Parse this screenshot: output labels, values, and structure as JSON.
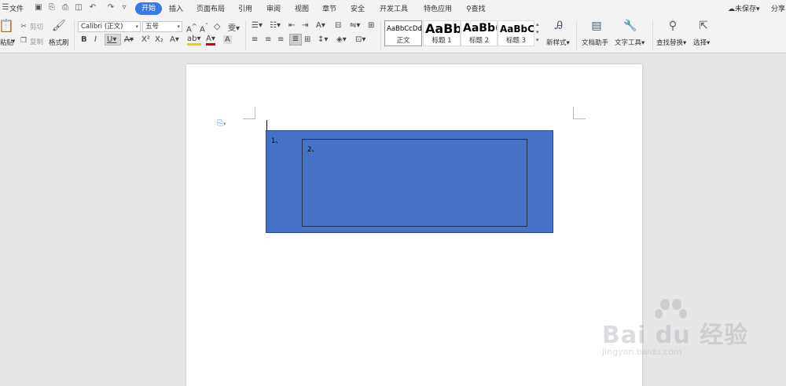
{
  "menubar": {
    "file": "文件",
    "tabs": [
      "开始",
      "插入",
      "页面布局",
      "引用",
      "审阅",
      "视图",
      "章节",
      "安全",
      "开发工具",
      "特色应用"
    ],
    "search": "查找",
    "unsaved": "未保存",
    "share": "分享"
  },
  "ribbon": {
    "paste": "粘贴",
    "cut": "剪切",
    "copy": "复制",
    "format_painter": "格式刷",
    "font_name": "Calibri (正文)",
    "font_size": "五号",
    "styles": [
      {
        "preview": "AaBbCcDd",
        "name": "正文"
      },
      {
        "preview": "AaBb",
        "name": "标题 1"
      },
      {
        "preview": "AaBb(",
        "name": "标题 2"
      },
      {
        "preview": "AaBbC",
        "name": "标题 3"
      }
    ],
    "new_style": "新样式",
    "doc_assistant": "文档助手",
    "text_tools": "文字工具",
    "find_replace": "查找替换",
    "select": "选择"
  },
  "document": {
    "outer_label": "1、",
    "inner_label": "2、",
    "box_fill": "#4472c4"
  },
  "watermark": {
    "brand": "Bai du 经验",
    "url": "jingyan.baidu.com"
  }
}
